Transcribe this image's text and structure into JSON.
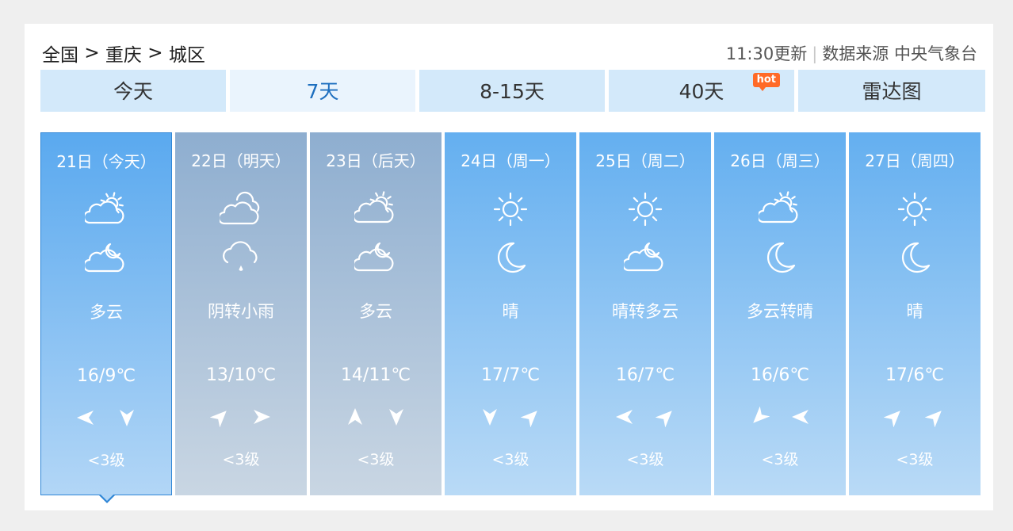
{
  "breadcrumb": {
    "country": "全国",
    "sep1": ">",
    "city": "重庆",
    "sep2": ">",
    "district": "城区"
  },
  "meta": {
    "update_time": "11:30更新",
    "separator": "|",
    "source_label": "数据来源",
    "source_name": "中央气象台"
  },
  "tabs": [
    {
      "label": "今天",
      "active": false
    },
    {
      "label": "7天",
      "active": true
    },
    {
      "label": "8-15天",
      "active": false
    },
    {
      "label": "40天",
      "active": false,
      "badge": "hot"
    },
    {
      "label": "雷达图",
      "active": false
    }
  ],
  "days": [
    {
      "date": "21日（今天）",
      "day_icon": "partly-cloudy-day-icon",
      "night_icon": "partly-cloudy-night-icon",
      "weather": "多云",
      "temp": "16/9℃",
      "wind": [
        "west-arrow-icon",
        "south-arrow-icon"
      ],
      "level": "<3级"
    },
    {
      "date": "22日（明天）",
      "day_icon": "cloudy-icon",
      "night_icon": "light-rain-icon",
      "weather": "阴转小雨",
      "temp": "13/10℃",
      "wind": [
        "northeast-arrow-icon",
        "east-arrow-icon"
      ],
      "level": "<3级"
    },
    {
      "date": "23日（后天）",
      "day_icon": "partly-cloudy-day-icon",
      "night_icon": "partly-cloudy-night-icon",
      "weather": "多云",
      "temp": "14/11℃",
      "wind": [
        "north-arrow-icon",
        "south-arrow-icon"
      ],
      "level": "<3级"
    },
    {
      "date": "24日（周一）",
      "day_icon": "sunny-icon",
      "night_icon": "moon-icon",
      "weather": "晴",
      "temp": "17/7℃",
      "wind": [
        "south-arrow-icon",
        "northeast-arrow-icon"
      ],
      "level": "<3级"
    },
    {
      "date": "25日（周二）",
      "day_icon": "sunny-icon",
      "night_icon": "partly-cloudy-night-icon",
      "weather": "晴转多云",
      "temp": "16/7℃",
      "wind": [
        "west-arrow-icon",
        "northeast-arrow-icon"
      ],
      "level": "<3级"
    },
    {
      "date": "26日（周三）",
      "day_icon": "partly-cloudy-day-icon",
      "night_icon": "moon-icon",
      "weather": "多云转晴",
      "temp": "16/6℃",
      "wind": [
        "southwest-arrow-icon",
        "west-arrow-icon"
      ],
      "level": "<3级"
    },
    {
      "date": "27日（周四）",
      "day_icon": "sunny-icon",
      "night_icon": "moon-icon",
      "weather": "晴",
      "temp": "17/6℃",
      "wind": [
        "northeast-arrow-icon",
        "northeast-arrow-icon"
      ],
      "level": "<3级"
    }
  ],
  "colors": {
    "tab_bg": "#d3e9fa",
    "tab_active_text": "#1e6fbf",
    "day_blue": "#64aff0",
    "day_grey": "#8eaed0",
    "hot_badge": "#ff6a28"
  }
}
